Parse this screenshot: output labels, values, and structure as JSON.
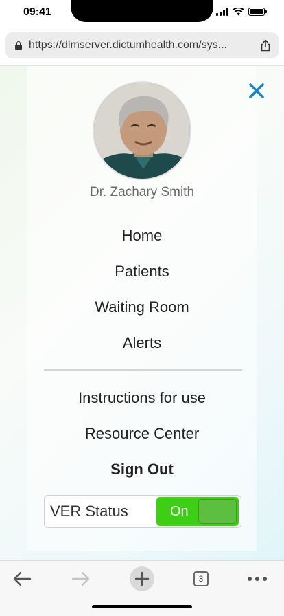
{
  "status_bar": {
    "time": "09:41"
  },
  "browser": {
    "url": "https://dlmserver.dictumhealth.com/sys..."
  },
  "profile": {
    "name": "Dr. Zachary Smith"
  },
  "menu": {
    "primary": [
      "Home",
      "Patients",
      "Waiting Room",
      "Alerts"
    ],
    "secondary": [
      "Instructions for use",
      "Resource Center"
    ],
    "sign_out": "Sign Out"
  },
  "ver_status": {
    "label": "VER Status",
    "toggle_text": "On",
    "enabled": true
  },
  "toolbar": {
    "tab_count": "3"
  },
  "colors": {
    "close_icon": "#1a86c8",
    "toggle_on": "#3ccf14"
  }
}
